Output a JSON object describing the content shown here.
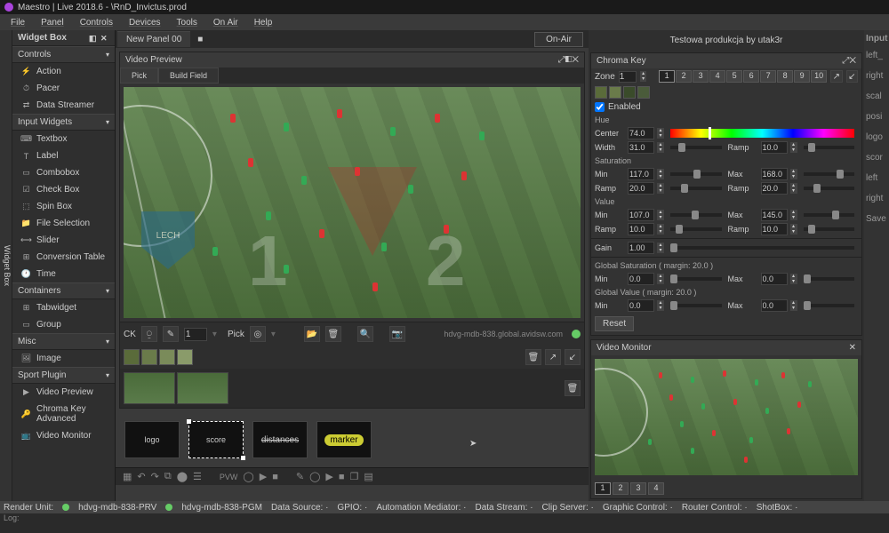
{
  "app": {
    "title": "Maestro | Live 2018.6 - \\RnD_Invictus.prod"
  },
  "menu": [
    "File",
    "Panel",
    "Controls",
    "Devices",
    "Tools",
    "On Air",
    "Help"
  ],
  "widgetbox": {
    "title": "Widget Box",
    "sections": [
      {
        "name": "Controls",
        "items": [
          "Action",
          "Pacer",
          "Data Streamer"
        ]
      },
      {
        "name": "Input Widgets",
        "items": [
          "Textbox",
          "Label",
          "Combobox",
          "Check Box",
          "Spin Box",
          "File Selection",
          "Slider",
          "Conversion Table",
          "Time"
        ]
      },
      {
        "name": "Containers",
        "items": [
          "Tabwidget",
          "Group"
        ]
      },
      {
        "name": "Misc",
        "items": [
          "Image"
        ]
      },
      {
        "name": "Sport Plugin",
        "items": [
          "Video Preview",
          "Chroma Key Advanced",
          "Video Monitor"
        ]
      }
    ]
  },
  "sidebar_tab": "Widget Box",
  "newpanel": "New Panel 00",
  "onair": "On-Air",
  "videopreview": {
    "title": "Video Preview",
    "tabs": [
      "Pick",
      "Build Field"
    ],
    "active": 0,
    "host": "hdvg-mdb-838.global.avidsw.com",
    "ck": "CK",
    "pick": "Pick",
    "ckval": "1"
  },
  "overlays": [
    "logo",
    "score",
    "distances",
    "marker"
  ],
  "production": "Testowa produkcja by utak3r",
  "chromakey": {
    "title": "Chroma Key",
    "zone_label": "Zone",
    "zone": "1",
    "zones": [
      "1",
      "2",
      "3",
      "4",
      "5",
      "6",
      "7",
      "8",
      "9",
      "10"
    ],
    "enabled": "Enabled",
    "hue": {
      "label": "Hue",
      "center": "74.0",
      "width": "31.0",
      "ramp": "10.0"
    },
    "sat": {
      "label": "Saturation",
      "min": "117.0",
      "ramp": "20.0",
      "max": "168.0",
      "ramp2": "20.0"
    },
    "val": {
      "label": "Value",
      "min": "107.0",
      "ramp": "10.0",
      "max": "145.0",
      "ramp2": "10.0"
    },
    "gain": {
      "label": "Gain",
      "val": "1.00"
    },
    "globsat": "Global Saturation  ( margin: 20.0 )",
    "globval": "Global Value  ( margin: 20.0 )",
    "gmin": "0.0",
    "gmax": "0.0",
    "reset": "Reset",
    "lbl_center": "Center",
    "lbl_width": "Width",
    "lbl_ramp": "Ramp",
    "lbl_min": "Min",
    "lbl_max": "Max"
  },
  "monitor": {
    "title": "Video Monitor",
    "tabs": [
      "1",
      "2",
      "3",
      "4"
    ]
  },
  "input_label": "Input",
  "rightlabels": [
    "left_",
    "right",
    "scal",
    "posi",
    "logo",
    "scor",
    "left",
    "right",
    "Save"
  ],
  "status": {
    "ru": "Render Unit:",
    "p1": "hdvg-mdb-838-PRV",
    "p2": "hdvg-mdb-838-PGM",
    "items": [
      "Data Source:",
      "GPIO:",
      "Automation Mediator:",
      "Data Stream:",
      "Clip Server:",
      "Graphic Control:",
      "Router Control:",
      "ShotBox:"
    ]
  },
  "log": "Log:",
  "pvw": "PVW"
}
